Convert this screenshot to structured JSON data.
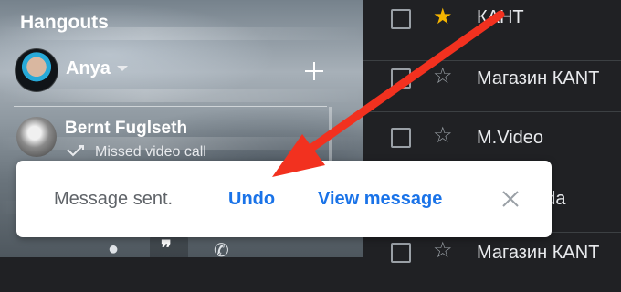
{
  "hangouts": {
    "title": "Hangouts",
    "user": {
      "name": "Anya"
    },
    "contacts": [
      {
        "name": "Bernt Fuglseth",
        "status": "Missed video call"
      }
    ]
  },
  "inbox": {
    "rows": [
      {
        "sender": "КАНТ",
        "starred": true
      },
      {
        "sender": "Магазин КАNT",
        "starred": false
      },
      {
        "sender": "M.Video",
        "starred": false
      },
      {
        "sender": "...esh Toda",
        "starred": false
      },
      {
        "sender": "Магазин КАNT",
        "starred": false
      }
    ]
  },
  "toast": {
    "message": "Message sent.",
    "undo_label": "Undo",
    "view_label": "View message"
  },
  "colors": {
    "link_blue": "#1a73e8",
    "arrow_red": "#f2311f",
    "star_yellow": "#f4b400"
  }
}
